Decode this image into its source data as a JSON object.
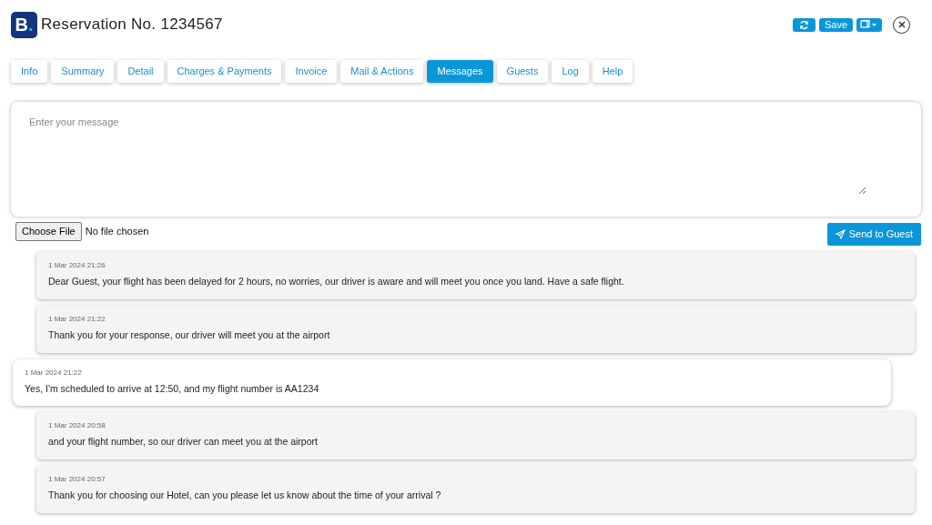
{
  "header": {
    "logo": {
      "letter": "B",
      "dot": "."
    },
    "title": "Reservation No. 1234567",
    "buttons": [
      {
        "kind": "refresh"
      },
      {
        "kind": "text",
        "label": "Save"
      },
      {
        "kind": "copy"
      },
      {
        "kind": "close"
      }
    ]
  },
  "tabs": [
    {
      "label": "Info",
      "selected": false
    },
    {
      "label": "Summary",
      "selected": false
    },
    {
      "label": "Detail",
      "selected": false
    },
    {
      "label": "Charges & Payments",
      "selected": false
    },
    {
      "label": "Invoice",
      "selected": false
    },
    {
      "label": "Mail & Actions",
      "selected": false
    },
    {
      "label": "Messages",
      "selected": true
    },
    {
      "label": "Guests",
      "selected": false
    },
    {
      "label": "Log",
      "selected": false
    },
    {
      "label": "Help",
      "selected": false
    }
  ],
  "composer": {
    "placeholder": "Enter your message",
    "file_button": "Choose File",
    "file_status": "No file chosen",
    "send_button": "Send to Guest"
  },
  "messages": [
    {
      "kind": "hotel",
      "time": "1 Mar 2024 21:26",
      "text": "Dear Guest, your flight has been delayed for 2 hours, no worries, our driver is aware and will meet you once you land. Have a safe flight."
    },
    {
      "kind": "hotel",
      "time": "1 Mar 2024 21:22",
      "text": "Thank you for your response, our driver will meet you at the airport"
    },
    {
      "kind": "guest",
      "time": "1 Mar 2024 21:22",
      "text": "Yes, I'm scheduled to arrive at 12:50, and my flight number is AA1234"
    },
    {
      "kind": "hotel",
      "time": "1 Mar 2024 20:58",
      "text": "and your flight number, so our driver can meet you at the airport"
    },
    {
      "kind": "hotel",
      "time": "1 Mar 2024 20:57",
      "text": "Thank you for choosing our Hotel, can you please let us know about the time of your arrival ?"
    }
  ]
}
